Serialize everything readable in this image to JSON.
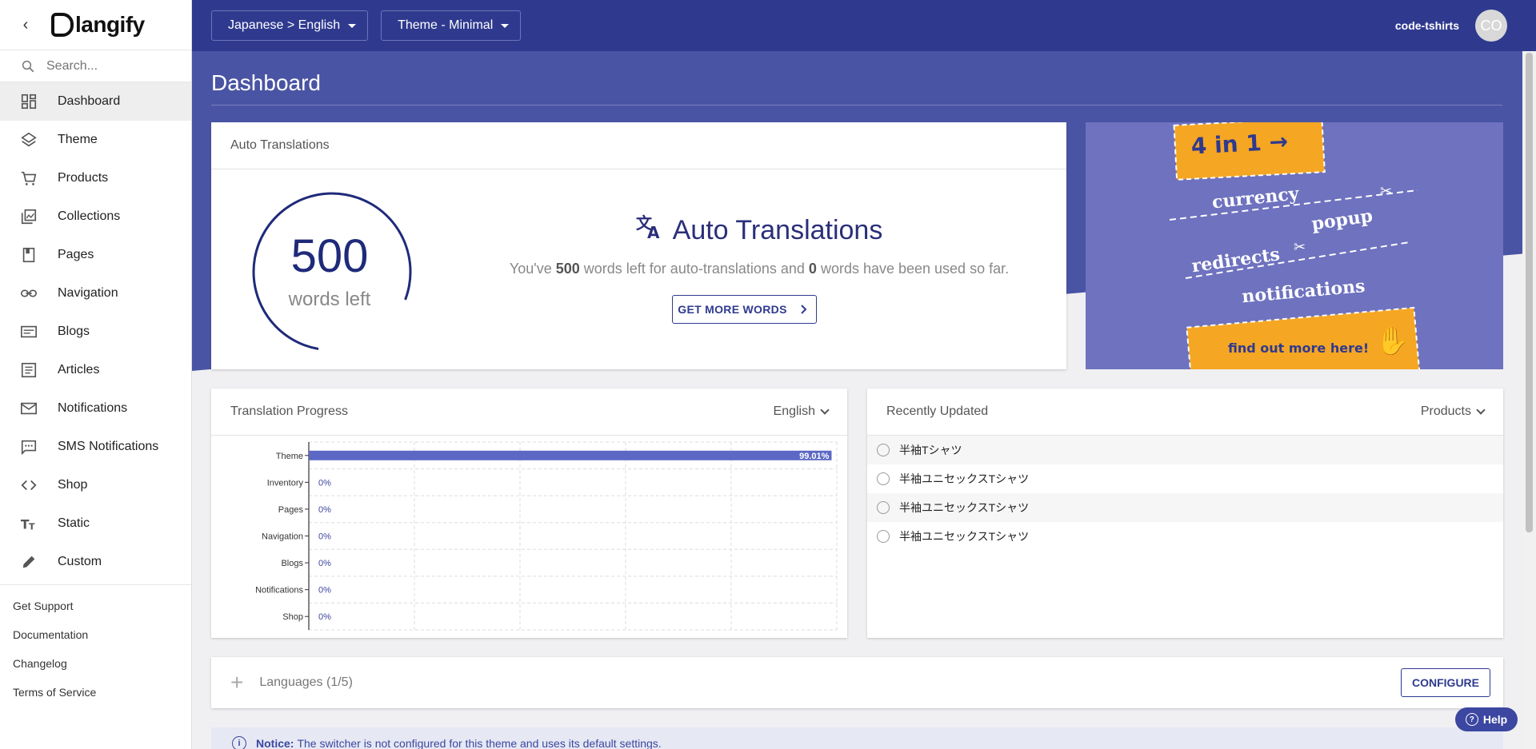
{
  "sidebar": {
    "logo_text": "langify",
    "search_placeholder": "Search...",
    "items": [
      {
        "label": "Dashboard",
        "icon": "dashboard-icon"
      },
      {
        "label": "Theme",
        "icon": "layers-icon"
      },
      {
        "label": "Products",
        "icon": "cart-icon"
      },
      {
        "label": "Collections",
        "icon": "collections-icon"
      },
      {
        "label": "Pages",
        "icon": "page-icon"
      },
      {
        "label": "Navigation",
        "icon": "link-icon"
      },
      {
        "label": "Blogs",
        "icon": "blog-icon"
      },
      {
        "label": "Articles",
        "icon": "article-icon"
      },
      {
        "label": "Notifications",
        "icon": "mail-icon"
      },
      {
        "label": "SMS Notifications",
        "icon": "sms-icon"
      },
      {
        "label": "Shop",
        "icon": "code-icon"
      },
      {
        "label": "Static",
        "icon": "text-icon"
      },
      {
        "label": "Custom",
        "icon": "pencil-icon"
      }
    ],
    "links": [
      "Get Support",
      "Documentation",
      "Changelog",
      "Terms of Service"
    ]
  },
  "topbar": {
    "language_pair": "Japanese > English",
    "theme_select": "Theme - Minimal",
    "user": "code-tshirts",
    "avatar_initials": "CO"
  },
  "dashboard": {
    "title": "Dashboard",
    "auto_translations": {
      "card_title": "Auto Translations",
      "words_left": "500",
      "words_left_label": "words left",
      "heading": "Auto Translations",
      "text_prefix": "You've ",
      "words_left_bold": "500",
      "text_middle": " words left for auto-translations and ",
      "words_used_bold": "0",
      "text_suffix": " words have been used so far.",
      "button": "GET MORE WORDS",
      "progress_fraction": 0.78
    },
    "promo": {
      "badge": "4 in 1 →",
      "items": [
        "currency",
        "popup",
        "redirects",
        "notifications"
      ],
      "cta": "find out more here!"
    },
    "translation_progress": {
      "card_title": "Translation Progress",
      "language": "English"
    },
    "recently_updated": {
      "card_title": "Recently Updated",
      "filter": "Products",
      "items": [
        "半袖Tシャツ",
        "半袖ユニセックスTシャツ",
        "半袖ユニセックスTシャツ",
        "半袖ユニセックスTシャツ"
      ]
    },
    "languages": {
      "label": "Languages (1/5)",
      "button": "CONFIGURE"
    },
    "notice": {
      "label": "Notice:",
      "text": "The switcher is not configured for this theme and uses its default settings."
    },
    "help_label": "Help"
  },
  "colors": {
    "topbar": "#2f3a8f",
    "hero": "#4a54a4",
    "bar": "#5c68c4",
    "promo_bg": "#6e72bf",
    "promo_accent": "#f5a623"
  },
  "chart_data": {
    "type": "bar",
    "orientation": "horizontal",
    "categories": [
      "Theme",
      "Inventory",
      "Pages",
      "Navigation",
      "Blogs",
      "Notifications",
      "Shop"
    ],
    "values": [
      99.01,
      0,
      0,
      0,
      0,
      0,
      0
    ],
    "value_labels": [
      "99.01%",
      "0%",
      "0%",
      "0%",
      "0%",
      "0%",
      "0%"
    ],
    "xlim": [
      0,
      100
    ],
    "grid": true
  }
}
